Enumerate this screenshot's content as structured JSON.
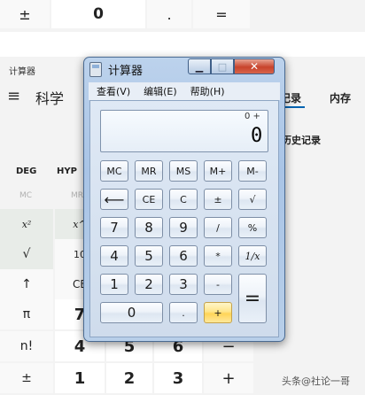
{
  "top_strip": {
    "keys": [
      "±",
      "0",
      ".",
      "="
    ]
  },
  "win10": {
    "title": "计算器",
    "menu_icon": "≡",
    "mode": "科学",
    "tab_history": "记录",
    "tab_memory": "内存",
    "no_history": "历史记录",
    "deg": "DEG",
    "hyp": "HYP",
    "mc": "MC",
    "mr": "MR",
    "left_col": [
      "x²",
      "√",
      "↑",
      "π",
      "n!",
      "±"
    ],
    "second_col": [
      "x^",
      "10",
      "CE",
      "7",
      "4",
      "1"
    ],
    "row_n": [
      "5",
      "6",
      "−"
    ],
    "row_last": [
      "2",
      "3",
      "+"
    ]
  },
  "win7": {
    "title": "计算器",
    "caption": {
      "minimize": "▁",
      "maximize": "□",
      "close": "✕"
    },
    "menu": [
      "查看(V)",
      "编辑(E)",
      "帮助(H)"
    ],
    "display": {
      "memory_line": "0 +",
      "value": "0"
    },
    "keys": {
      "r1": [
        "MC",
        "MR",
        "MS",
        "M+",
        "M-"
      ],
      "r2": [
        "⟵",
        "CE",
        "C",
        "±",
        "√"
      ],
      "r3": [
        "7",
        "8",
        "9",
        "/",
        "%"
      ],
      "r4": [
        "4",
        "5",
        "6",
        "*",
        "1/x"
      ],
      "r5": [
        "1",
        "2",
        "3",
        "-"
      ],
      "r6": [
        "0",
        ".",
        "+"
      ],
      "equals": "="
    }
  },
  "watermark": "头条@社论一哥"
}
